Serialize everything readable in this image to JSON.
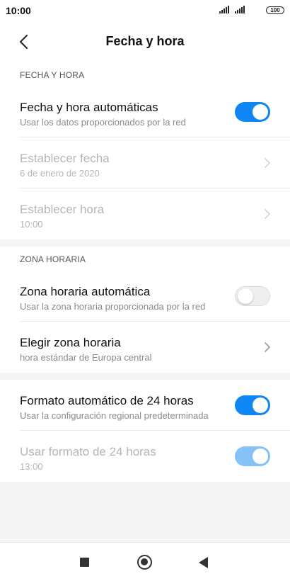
{
  "status_bar": {
    "time": "10:00",
    "battery": "100"
  },
  "header": {
    "title": "Fecha y hora"
  },
  "sections": {
    "datetime": {
      "header": "FECHA Y HORA",
      "auto": {
        "title": "Fecha y hora automáticas",
        "subtitle": "Usar los datos proporcionados por la red",
        "toggle": "on"
      },
      "set_date": {
        "title": "Establecer fecha",
        "subtitle": "6 de enero de 2020"
      },
      "set_time": {
        "title": "Establecer hora",
        "subtitle": "10:00"
      }
    },
    "timezone": {
      "header": "ZONA HORARIA",
      "auto": {
        "title": "Zona horaria automática",
        "subtitle": "Usar la zona horaria proporcionada por la red",
        "toggle": "off"
      },
      "choose": {
        "title": "Elegir zona horaria",
        "subtitle": "hora estándar de Europa central"
      }
    },
    "format": {
      "auto24": {
        "title": "Formato automático de 24 horas",
        "subtitle": "Usar la configuración regional predeterminada",
        "toggle": "on"
      },
      "use24": {
        "title": "Usar formato de 24 horas",
        "subtitle": "13:00",
        "toggle": "on-disabled"
      }
    }
  },
  "colors": {
    "accent": "#0f86f3",
    "accent_disabled": "#86c1f8",
    "background": "#f5f5f5"
  }
}
